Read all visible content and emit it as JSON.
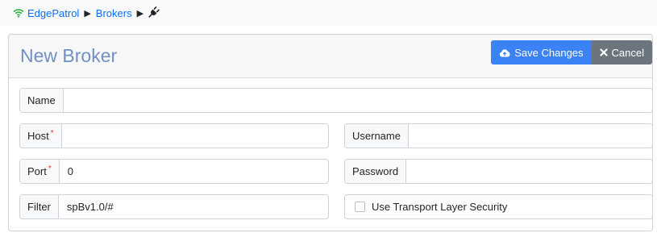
{
  "breadcrumb": {
    "root": "EdgePatrol",
    "section": "Brokers"
  },
  "header": {
    "title": "New Broker",
    "save_label": "Save Changes",
    "cancel_label": "Cancel"
  },
  "form": {
    "name": {
      "label": "Name",
      "value": ""
    },
    "host": {
      "label": "Host",
      "value": "",
      "required": true
    },
    "port": {
      "label": "Port",
      "value": "0",
      "required": true
    },
    "filter": {
      "label": "Filter",
      "value": "spBv1.0/#"
    },
    "username": {
      "label": "Username",
      "value": ""
    },
    "password": {
      "label": "Password",
      "value": ""
    },
    "tls": {
      "label": "Use Transport Layer Security",
      "checked": false
    },
    "required_mark": "*"
  },
  "icons": {
    "root": "wifi-icon",
    "separator": "caret-right-icon",
    "current": "plug-icon",
    "save": "cloud-upload-icon",
    "cancel": "x-icon"
  },
  "colors": {
    "primary": "#3b82f6",
    "secondary": "#6c757d",
    "title": "#6f8fc7",
    "link": "#0d6efd",
    "wifi": "#2fb344"
  }
}
